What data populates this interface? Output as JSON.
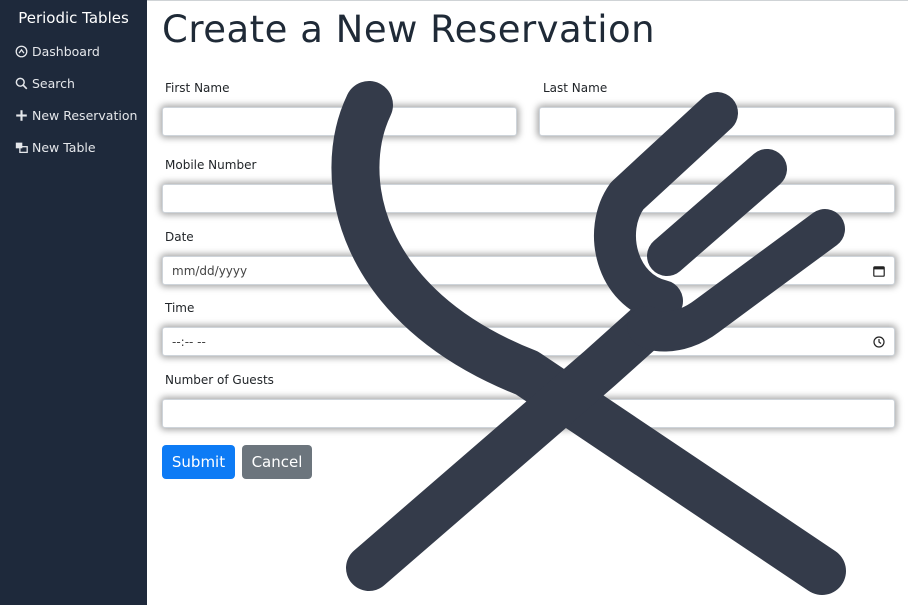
{
  "sidebar": {
    "brand": "Periodic Tables",
    "items": [
      {
        "label": "Dashboard",
        "icon": "dashboard-icon"
      },
      {
        "label": "Search",
        "icon": "search-icon"
      },
      {
        "label": "New Reservation",
        "icon": "plus-icon"
      },
      {
        "label": "New Table",
        "icon": "table-icon"
      }
    ]
  },
  "page": {
    "title": "Create a New Reservation"
  },
  "form": {
    "first_name_label": "First Name",
    "last_name_label": "Last Name",
    "mobile_label": "Mobile Number",
    "date_label": "Date",
    "date_placeholder": "mm/dd/yyyy",
    "time_label": "Time",
    "time_placeholder": "--:-- --",
    "guests_label": "Number of Guests",
    "submit_label": "Submit",
    "cancel_label": "Cancel"
  },
  "colors": {
    "sidebar_bg": "#1e293b",
    "primary": "#0d7bf5",
    "secondary": "#6c757d",
    "watermark": "#343b4a"
  }
}
